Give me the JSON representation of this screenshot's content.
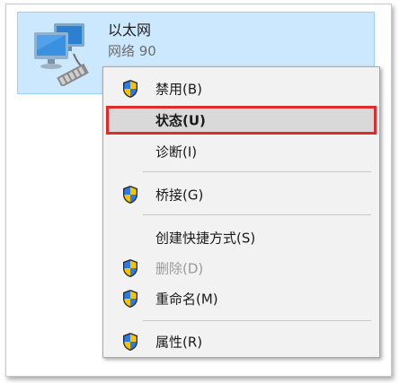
{
  "adapter": {
    "name": "以太网",
    "status": "网络  90",
    "icon": "network-adapter-icon"
  },
  "context_menu": {
    "items": [
      {
        "label": "禁用(B)",
        "icon": "uac-shield-icon",
        "enabled": true
      },
      {
        "label": "状态(U)",
        "icon": null,
        "enabled": true,
        "highlighted": true
      },
      {
        "label": "诊断(I)",
        "icon": null,
        "enabled": true
      },
      {
        "label": "桥接(G)",
        "icon": "uac-shield-icon",
        "enabled": true
      },
      {
        "label": "创建快捷方式(S)",
        "icon": null,
        "enabled": true
      },
      {
        "label": "删除(D)",
        "icon": "uac-shield-icon",
        "enabled": false
      },
      {
        "label": "重命名(M)",
        "icon": "uac-shield-icon",
        "enabled": true
      },
      {
        "label": "属性(R)",
        "icon": "uac-shield-icon",
        "enabled": true
      }
    ]
  },
  "colors": {
    "selection_background": "#cce8ff",
    "selection_border": "#99d1ff",
    "menu_background": "#f2f2f2",
    "highlight_background": "#d9d9d9",
    "highlight_outline": "#e02b2b",
    "disabled_text": "#9a9a9a"
  }
}
